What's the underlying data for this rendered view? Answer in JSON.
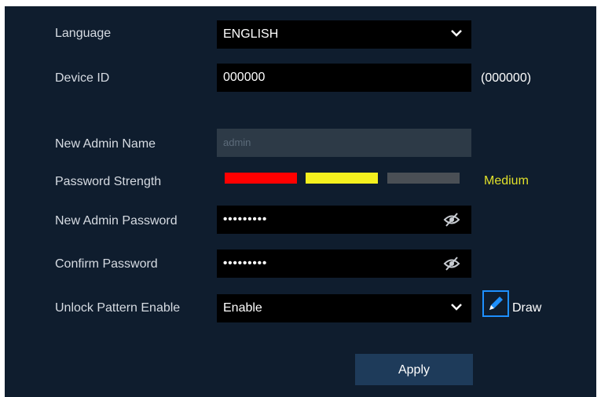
{
  "form": {
    "language_label": "Language",
    "language_value": "ENGLISH",
    "device_id_label": "Device ID",
    "device_id_value": "000000",
    "device_id_hint": "(000000)",
    "admin_name_label": "New Admin Name",
    "admin_name_placeholder": "admin",
    "strength_label": "Password Strength",
    "strength_text": "Medium",
    "strength_level": 2,
    "strength_levels_total": 3,
    "strength_colors": [
      "#ff0000",
      "#f5f01e",
      "#4a4f55"
    ],
    "admin_password_label": "New Admin Password",
    "admin_password_value": "•••••••••",
    "confirm_label": "Confirm Password",
    "confirm_value": "•••••••••",
    "unlock_label": "Unlock Pattern Enable",
    "unlock_value": "Enable",
    "draw_label": "Draw",
    "apply_label": "Apply"
  },
  "icons": {
    "dropdown": "chevron-down-icon",
    "visibility": "eye-off-icon",
    "draw": "pencil-icon"
  },
  "colors": {
    "panel_bg": "#0f1d2e",
    "field_bg": "#000000",
    "accent": "#1e90ff",
    "medium": "#e0e02a"
  }
}
